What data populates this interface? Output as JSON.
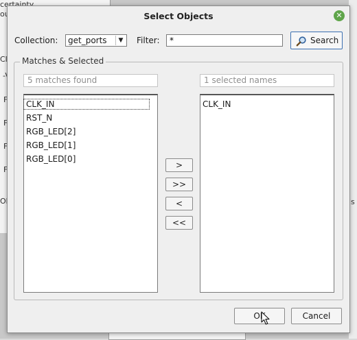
{
  "background": {
    "text_lines": [
      "certainty",
      "ou",
      "Clo",
      "-V",
      "F",
      "F",
      "F",
      "F",
      "Ob"
    ],
    "right_text": "ls"
  },
  "dialog": {
    "title": "Select Objects",
    "close_icon": "close-icon",
    "collection_label": "Collection:",
    "collection_value": "get_ports",
    "filter_label": "Filter:",
    "filter_value": "*",
    "search_label": "Search",
    "group_title": "Matches & Selected",
    "matches_count": "5 matches found",
    "selected_count": "1 selected names",
    "matches": [
      "CLK_IN",
      "RST_N",
      "RGB_LED[2]",
      "RGB_LED[1]",
      "RGB_LED[0]"
    ],
    "selected": [
      "CLK_IN"
    ],
    "move_buttons": [
      ">",
      ">>",
      "<",
      "<<"
    ],
    "ok_label": "OK",
    "cancel_label": "Cancel"
  },
  "colors": {
    "close_button": "#5fa54a",
    "search_border": "#3a6fb0"
  }
}
